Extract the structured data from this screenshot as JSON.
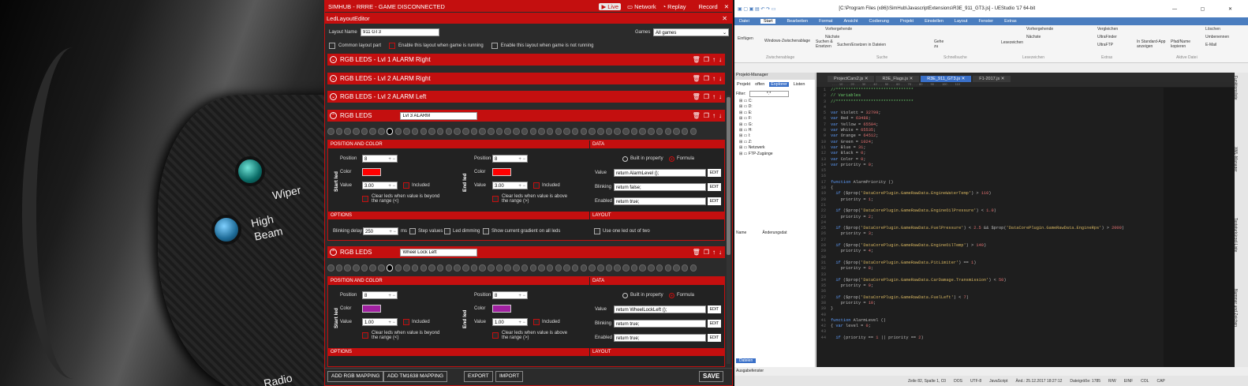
{
  "simhub": {
    "title": "SIMHUB - RRRE - GAME DISCONNECTED",
    "live": "Live",
    "network": "Network",
    "replay": "Replay",
    "record": "Record",
    "editor_title": "LedLayoutEditor",
    "layout_name_label": "Layout Name",
    "layout_name_value": "911 GT3",
    "games_label": "Games",
    "games_value": "All games",
    "common_layout": "Common layout part",
    "enable_running": "Enable this layout when game is running",
    "enable_not_running": "Enable this layout when game is not running",
    "sections": [
      {
        "title": "RGB LEDS - Lvl 1 ALARM Right"
      },
      {
        "title": "RGB LEDS - Lvl 2 ALARM Right"
      },
      {
        "title": "RGB LEDS - Lvl 2 ALARM Left"
      }
    ],
    "panels": [
      {
        "title": "RGB LEDS",
        "name": "Lvl 3 ALARM",
        "pos_color": "POSITION AND COLOR",
        "data": "DATA",
        "start_led": "Start led",
        "end_led": "End led",
        "position_label": "Position",
        "color_label": "Color",
        "value_label": "Value",
        "start_position": "8",
        "end_position": "8",
        "start_color": "#ff0000",
        "end_color": "#ff0000",
        "start_value": "3.00",
        "end_value": "3.00",
        "included": "Included",
        "clear_below": "Clear leds when value is beyond the range (<)",
        "clear_above": "Clear leds when value is above the range (>)",
        "built_in": "Built in property",
        "formula": "Formula",
        "data_value_label": "Value",
        "data_value": "return AlarmLevel ();",
        "blinking_label": "Blinking",
        "blinking": "return false;",
        "enabled_label": "Enabled",
        "enabled": "return true;",
        "edit": "EDIT",
        "options": "OPTIONS",
        "layout": "LAYOUT",
        "blink_delay_label": "Blinking delay",
        "blink_delay": "250",
        "ms": "ms",
        "step_values": "Step values",
        "led_dimming": "Led dimming",
        "show_gradient": "Show current gradient on all leds",
        "one_out_of_two": "Use one led out of two"
      },
      {
        "title": "RGB LEDS",
        "name": "Wheel Lock Left",
        "pos_color": "POSITION AND COLOR",
        "data": "DATA",
        "start_led": "Start led",
        "end_led": "End led",
        "position_label": "Position",
        "color_label": "Color",
        "value_label": "Value",
        "start_position": "8",
        "end_position": "8",
        "start_color": "#a020a0",
        "end_color": "#a020a0",
        "start_value": "1.00",
        "end_value": "1.00",
        "included": "Included",
        "clear_below": "Clear leds when value is beyond the range (<)",
        "clear_above": "Clear leds when value is above the range (>)",
        "built_in": "Built in property",
        "formula": "Formula",
        "data_value_label": "Value",
        "data_value": "return WheelLockLeft ();",
        "blinking_label": "Blinking",
        "blinking": "return true;",
        "enabled_label": "Enabled",
        "enabled": "return true;",
        "edit": "EDIT",
        "options": "OPTIONS",
        "layout": "LAYOUT"
      }
    ],
    "footer": {
      "add_rgb": "ADD RGB MAPPING",
      "add_tm": "ADD TM1638 MAPPING",
      "export": "EXPORT",
      "import": "IMPORT",
      "save": "SAVE"
    }
  },
  "background": {
    "label_wiper": "Wiper",
    "label_high": "High",
    "label_beam": "Beam",
    "label_radio": "Radio"
  },
  "ue": {
    "title": "[C:\\Program Files (x86)\\SimHub\\JavascriptExtensions\\R3E_911_GT3.js] - UEStudio '17 64-bit",
    "tabs": [
      "Datei",
      "Start",
      "Bearbeiten",
      "Format",
      "Ansicht",
      "Codierung",
      "Projekt",
      "Einstellen",
      "Layout",
      "Fenster",
      "Extras"
    ],
    "ribbon": {
      "einfuegen": "Einfügen",
      "windows_zw": "Windows-Zwischenablage",
      "vorhergehende": "Vorhergehende",
      "naechste": "Nächste",
      "suchen_ersetzen": "Suchen & Ersetzen",
      "suchen_datei": "Suchen/Ersetzen in Dateien",
      "gehe_zu": "Gehe zu",
      "lesezeichen": "Lesezeichen",
      "vergleichen": "Vergleichen",
      "ultrafinder": "UltraFinder",
      "ultraftp": "UltraFTP",
      "loeschen": "Löschen",
      "umbenennen": "Umbenennen",
      "email": "E-Mail",
      "standard_app": "In Standard-App anzeigen",
      "pfad_kopieren": "Pfad/Name kopieren",
      "grp_zw": "Zwischenablage",
      "grp_suche": "Suche",
      "grp_schnell": "Schnellsuche",
      "grp_lz": "Lesezeichen",
      "grp_extras": "Extras",
      "grp_aktive": "Aktive Datei"
    },
    "project_manager": "Projekt-Manager",
    "pm_tabs": [
      "Projekt",
      "offen",
      "Explorer",
      "Listen"
    ],
    "filter_label": "Filter:",
    "filter_value": "*.*",
    "drives": [
      "C:",
      "D:",
      "E:",
      "F:",
      "G:",
      "H:",
      "I:",
      "Z:",
      "Netzwerk",
      "FTP-Zugänge"
    ],
    "col_name": "Name",
    "col_changed": "Änderungsdat",
    "dateien": "Dateien",
    "ausgabe": "Ausgabefenster",
    "file_tabs": [
      "ProjectCars2.js",
      "R3E_Flags.js",
      "R3E_911_GT3.js",
      "F1-2017.js"
    ],
    "code_lines": [
      "//*******************************",
      "// Variables",
      "//*******************************",
      "",
      "var Violett = 32799;",
      "var Red = 63488;",
      "var Yellow = 65504;",
      "var White = 65535;",
      "var Orange = 64512;",
      "var Green = 1024;",
      "var Blue = 31;",
      "var Black = 0;",
      "var Color = 0;",
      "var priority = 0;",
      "",
      "",
      "function AlarmPriority ()",
      "{",
      "  if ($prop('DataCorePlugin.GameRawData.EngineWaterTemp') > 110)",
      "    priority = 1;",
      "",
      "  if ($prop('DataCorePlugin.GameRawData.EngineOilPressure') < 1.0)",
      "    priority = 2;",
      "",
      "  if ($prop('DataCorePlugin.GameRawData.FuelPressure') < 2.5 && $prop('DataCorePlugin.GameRawData.EngineRps') > 2000)",
      "    priority = 3;",
      "",
      "  if ($prop('DataCorePlugin.GameRawData.EngineOilTemp') > 140)",
      "    priority = 4;",
      "",
      "  if ($prop('DataCorePlugin.GameRawData.PitLimiter') == 1)",
      "    priority = 8;",
      "",
      "  if ($prop('DataCorePlugin.GameRawData.CarDamage.Transmission') < 50)",
      "    priority = 9;",
      "",
      "  if ($prop('DataCorePlugin.GameRawData.FuelLeft') < 7)",
      "    priority = 10;",
      "}",
      "",
      "function AlarmLevel ()",
      "{ var level = 0;",
      "",
      "  if (priority == 1 || priority == 2)"
    ],
    "side_labels": [
      "Funktionsliste",
      "XML-Manager",
      "Tastaturkürzel-Liste",
      "Nummer und Zeichen"
    ],
    "status": {
      "pos": "Zeile 82, Spalte 1, C0",
      "eol": "DOS",
      "enc": "UTF-8",
      "lang": "JavaScript",
      "mod": "Änd.: 25.12.2017 18:27:12",
      "size": "Dateigröße: 1785",
      "rw": "R/W",
      "ins": "EINF",
      "col": "COL",
      "cap": "CAP"
    }
  }
}
